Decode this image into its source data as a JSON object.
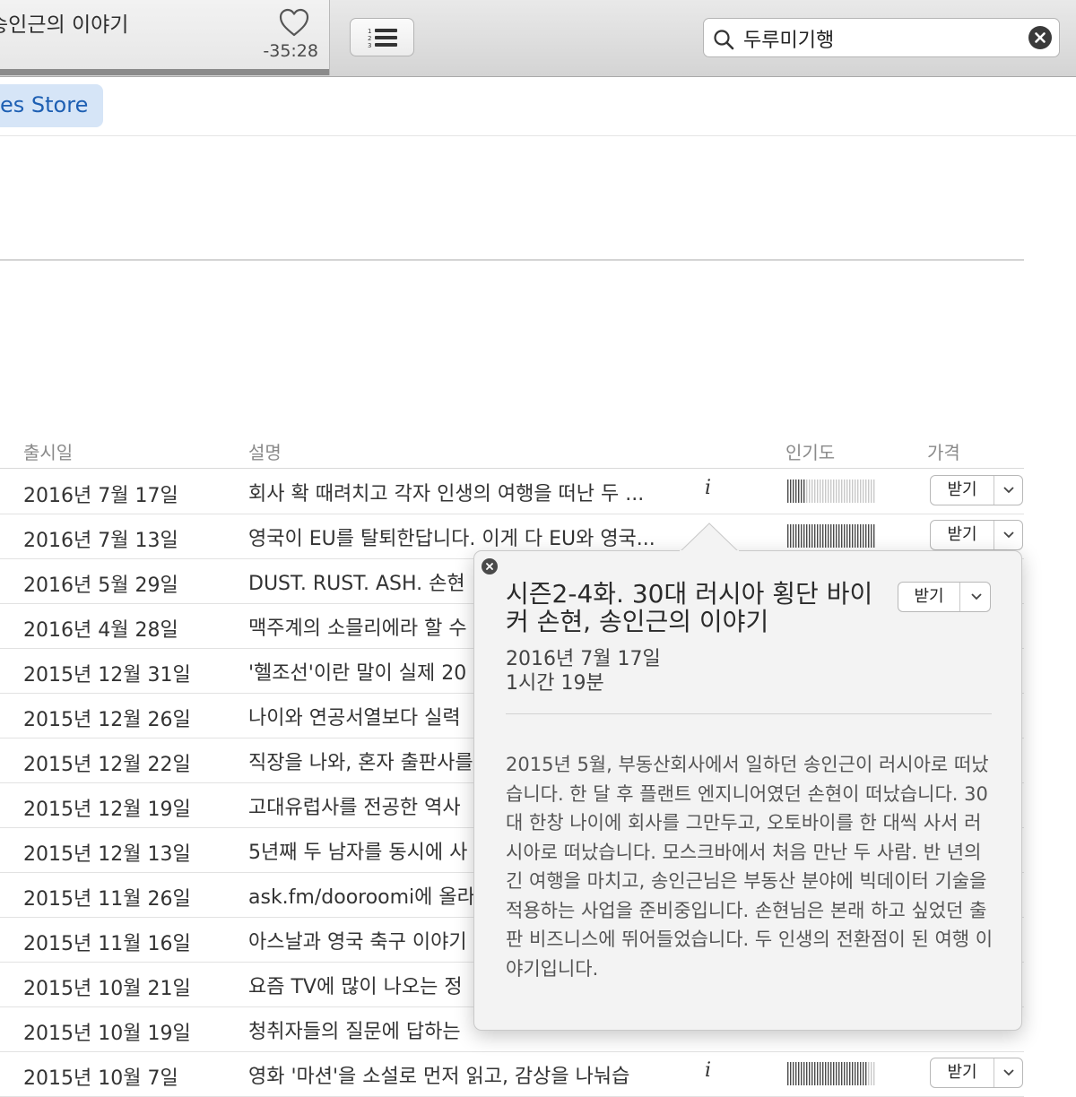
{
  "toolbar": {
    "now_playing_title": "송인근의 이야기",
    "remaining_time": "-35:28",
    "progress": 1.0,
    "search_value": "두루미기행"
  },
  "store_tab": {
    "label": "es Store"
  },
  "table": {
    "columns": {
      "date": "출시일",
      "description": "설명",
      "popularity": "인기도",
      "price": "가격"
    },
    "get_label": "받기",
    "rows": [
      {
        "date": "2016년 7월 17일",
        "description": "회사 확 때려치고 각자 인생의 여행을 떠난 두 ...",
        "info": "i",
        "popularity": 0.2,
        "get": "받기"
      },
      {
        "date": "2016년 7월 13일",
        "description": "영국이 EU를 탈퇴한답니다. 이게 다 EU와 영국...",
        "info": "",
        "popularity": 1.0,
        "get": "받기"
      },
      {
        "date": "2016년 5월 29일",
        "description": "DUST. RUST. ASH. 손현"
      },
      {
        "date": "2016년 4월 28일",
        "description": "맥주계의 소믈리에라 할 수"
      },
      {
        "date": "2015년 12월 31일",
        "description": "'헬조선'이란 말이 실제 20"
      },
      {
        "date": "2015년 12월 26일",
        "description": "나이와 연공서열보다 실력"
      },
      {
        "date": "2015년 12월 22일",
        "description": "직장을 나와, 혼자 출판사를"
      },
      {
        "date": "2015년 12월 19일",
        "description": "고대유럽사를 전공한 역사"
      },
      {
        "date": "2015년 12월 13일",
        "description": "5년째 두 남자를 동시에 사"
      },
      {
        "date": "2015년 11월 26일",
        "description": "ask.fm/dooroomi에 올라"
      },
      {
        "date": "2015년 11월 16일",
        "description": "아스날과 영국 축구 이야기"
      },
      {
        "date": "2015년 10월 21일",
        "description": "요즘 TV에 많이 나오는 정"
      },
      {
        "date": "2015년 10월 19일",
        "description": "청취자들의 질문에 답하는"
      },
      {
        "date": "2015년 10월 7일",
        "description": "영화 '마션'을 소설로 먼저 읽고, 감상을 나눠습",
        "info": "i",
        "popularity": 0.9,
        "get": "받기"
      }
    ]
  },
  "popover": {
    "title": "시즌2-4화. 30대 러시아 횡단 바이커 손현, 송인근의 이야기",
    "get_label": "받기",
    "date": "2016년 7월 17일",
    "duration": "1시간 19분",
    "description": "2015년 5월, 부동산회사에서 일하던 송인근이 러시아로 떠났습니다. 한 달 후 플랜트 엔지니어였던 손현이 떠났습니다. 30대 한창 나이에 회사를 그만두고, 오토바이를 한 대씩 사서 러시아로 떠났습니다. 모스크바에서 처음 만난 두 사람. 반 년의 긴 여행을 마치고, 송인근님은 부동산 분야에 빅데이터 기술을 적용하는 사업을 준비중입니다. 손현님은 본래 하고 싶었던 출판 비즈니스에 뛰어들었습니다. 두 인생의 전환점이 된 여행 이야기입니다."
  },
  "icons": {
    "heart": "heart-icon",
    "list": "numbered-list-icon",
    "search": "search-icon",
    "clear": "clear-search-icon",
    "close": "close-icon",
    "chevron": "chevron-down-icon"
  },
  "colors": {
    "accent": "#1d5fb3",
    "tab_bg": "#d6e5f7"
  }
}
